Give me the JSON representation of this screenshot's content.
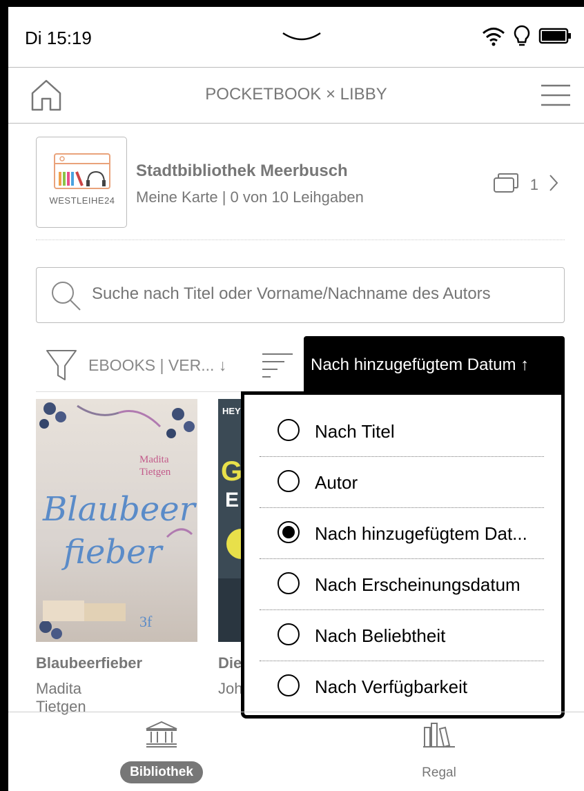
{
  "status": {
    "time": "Di 15:19"
  },
  "header": {
    "title": "POCKETBOOK × LIBBY"
  },
  "library": {
    "logo_text": "WESTLEIHE24",
    "name": "Stadtbibliothek Meerbusch",
    "subtitle": "Meine Karte | 0 von 10 Leihgaben",
    "count": "1"
  },
  "search": {
    "placeholder": "Suche nach Titel oder Vorname/Nachname des Autors"
  },
  "filter": {
    "label": "EBOOKS | VER... ↓"
  },
  "sort": {
    "active_label": "Nach hinzugefügtem Datum ↑"
  },
  "sort_options": [
    {
      "label": "Nach Titel",
      "selected": false
    },
    {
      "label": "Autor",
      "selected": false
    },
    {
      "label": "Nach hinzugefügtem Dat...",
      "selected": true
    },
    {
      "label": "Nach Erscheinungsdatum",
      "selected": false
    },
    {
      "label": "Nach Beliebtheit",
      "selected": false
    },
    {
      "label": "Nach Verfügbarkeit",
      "selected": false
    }
  ],
  "books": [
    {
      "title": "Blaubeerfieber",
      "author": "Madita Tietgen",
      "cover_author": "Madita Tietgen",
      "cover_title_1": "Blaubeer",
      "cover_title_2": "fieber"
    },
    {
      "title": "Die",
      "author": "Joh",
      "cover_top": "HEY",
      "cover_letter": "G",
      "cover_letter2": "E"
    }
  ],
  "nav": {
    "library": "Bibliothek",
    "shelf": "Regal"
  }
}
